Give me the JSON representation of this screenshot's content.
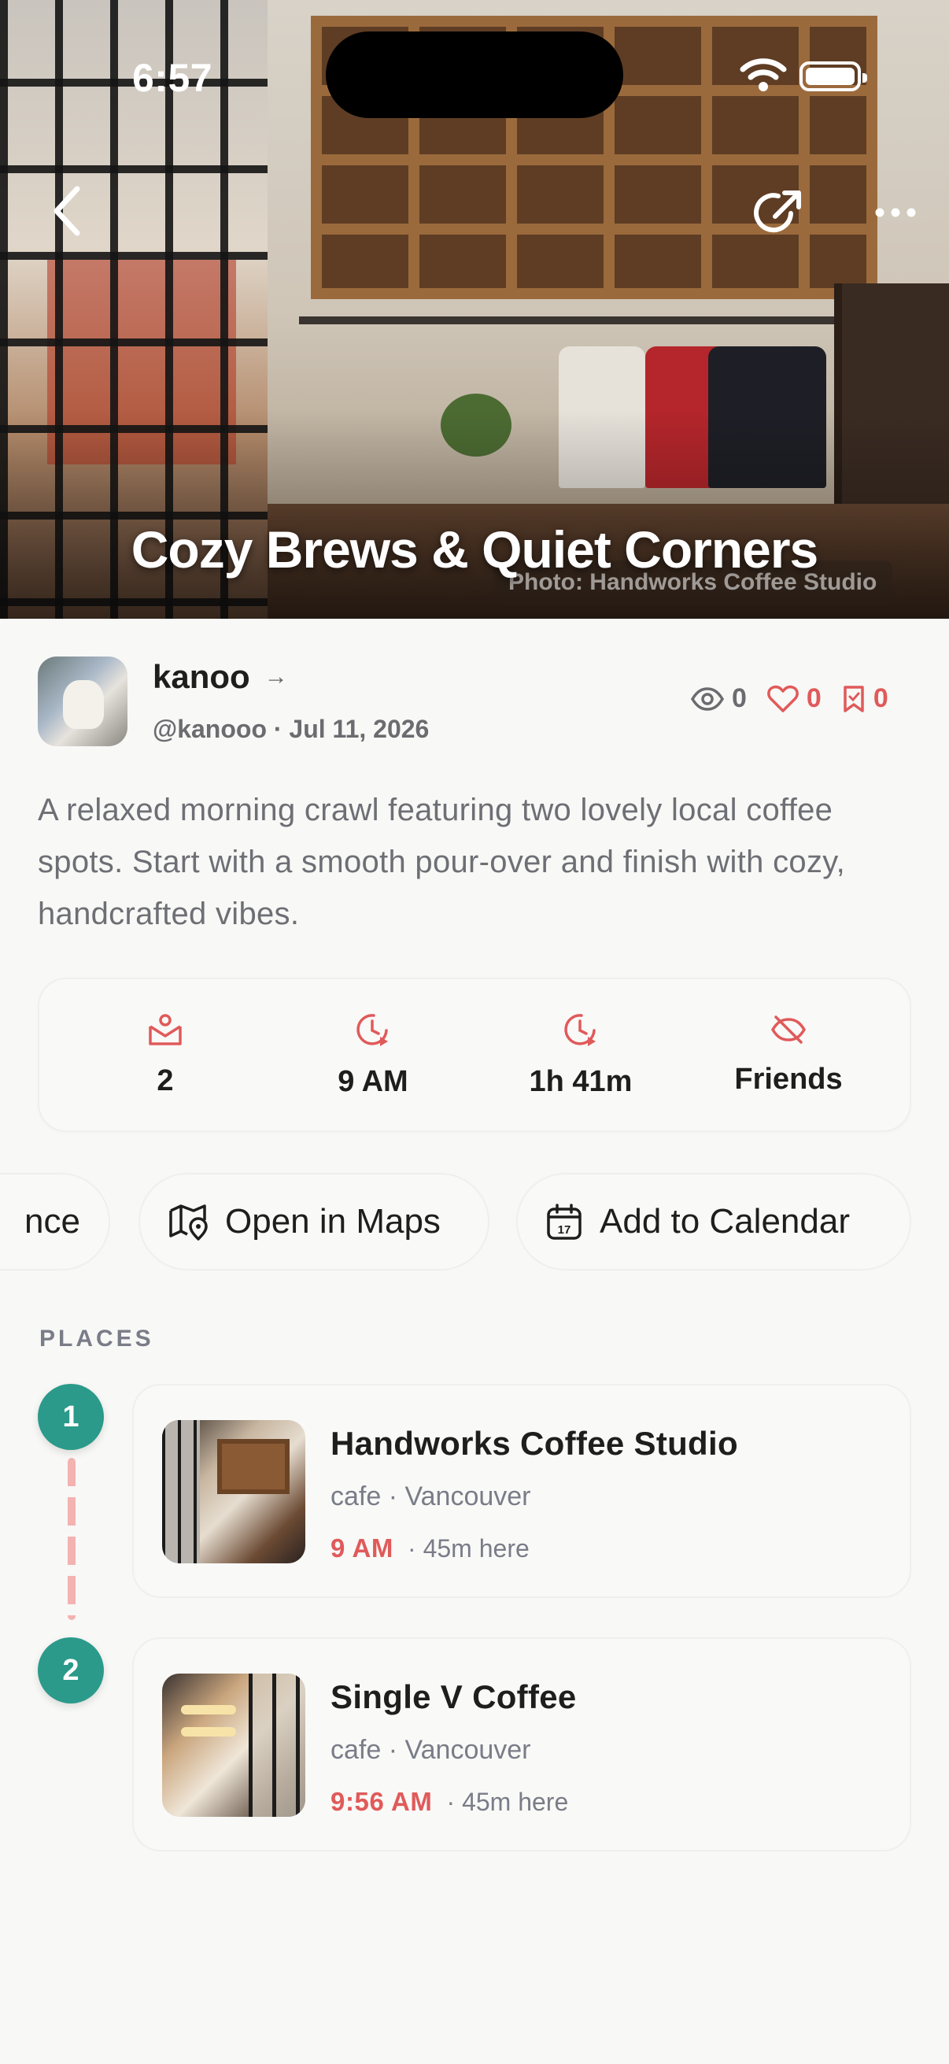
{
  "status_bar": {
    "time": "6:57"
  },
  "hero": {
    "title": "Cozy Brews & Quiet Corners",
    "photo_credit": "Photo: Handworks Coffee Studio"
  },
  "author": {
    "name": "kanoo",
    "handle_date": "@kanooo · Jul 11, 2026"
  },
  "stats": {
    "views": "0",
    "likes": "0",
    "saves": "0"
  },
  "description": "A relaxed morning crawl featuring two lovely local coffee spots. Start with a smooth pour-over and finish with cozy, handcrafted vibes.",
  "info": {
    "stops": "2",
    "start_time": "9 AM",
    "duration": "1h 41m",
    "visibility": "Friends"
  },
  "actions": {
    "prev_chip": "nce",
    "open_maps": "Open in Maps",
    "add_calendar": "Add to Calendar"
  },
  "places_label": "PLACES",
  "places": [
    {
      "step": "1",
      "name": "Handworks Coffee Studio",
      "sub": "cafe · Vancouver",
      "time": "9 AM",
      "duration": "· 45m here"
    },
    {
      "step": "2",
      "name": "Single V Coffee",
      "sub": "cafe · Vancouver",
      "time": "9:56 AM",
      "duration": "· 45m here"
    }
  ],
  "colors": {
    "accent": "#e05a5a",
    "teal": "#2b9a8a",
    "muted": "#7a7c88",
    "background": "#f8f8f6"
  },
  "icons": [
    "back-icon",
    "share-icon",
    "more-icon",
    "eye-icon",
    "heart-icon",
    "bookmark-icon",
    "stops-icon",
    "clock-icon",
    "duration-icon",
    "eye-off-icon",
    "map-icon",
    "calendar-icon"
  ]
}
